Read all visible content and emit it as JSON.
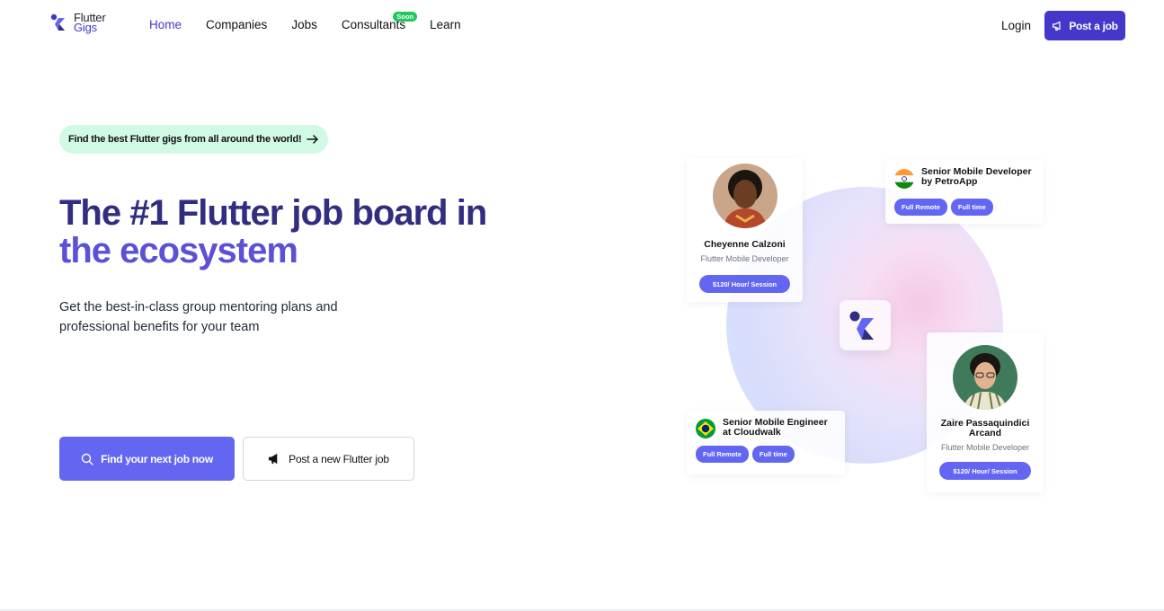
{
  "brand": {
    "line1": "Flutter",
    "line2": "Gigs",
    "accent": "#4338ca"
  },
  "nav": {
    "links": [
      {
        "label": "Home",
        "active": true
      },
      {
        "label": "Companies"
      },
      {
        "label": "Jobs"
      },
      {
        "label": "Consultants",
        "badge": "Soon"
      },
      {
        "label": "Learn"
      }
    ],
    "login": "Login",
    "post_job": "Post a job"
  },
  "hero": {
    "pill": "Find the best Flutter gigs from all around the world!",
    "headline_1": "The #1 Flutter job board in",
    "headline_2": "the ecosystem",
    "subtitle_1": "Get the best-in-class group mentoring plans and",
    "subtitle_2": "professional benefits for your team",
    "primary_cta": "Find your next job now",
    "secondary_cta": "Post a new Flutter job"
  },
  "cards": {
    "profile1": {
      "name": "Cheyenne Calzoni",
      "role": "Flutter Mobile Developer",
      "rate": "$120/ Hour/ Session"
    },
    "job1": {
      "title_1": "Senior Mobile Developer",
      "title_2": "by PetroApp",
      "flag": "india-flag-icon",
      "tags": [
        "Full Remote",
        "Full time"
      ]
    },
    "job2": {
      "title_1": "Senior Mobile Engineer",
      "title_2": "at Cloudwalk",
      "flag": "brazil-flag-icon",
      "tags": [
        "Full Remote",
        "Full time"
      ]
    },
    "profile2": {
      "name_1": "Zaire Passaquindici",
      "name_2": "Arcand",
      "role": "Flutter Mobile Developer",
      "rate": "$120/ Hour/ Session"
    }
  },
  "colors": {
    "primary": "#6366f1",
    "deep": "#312e81",
    "pill_bg": "#d1fae5",
    "soon": "#22c55e"
  }
}
